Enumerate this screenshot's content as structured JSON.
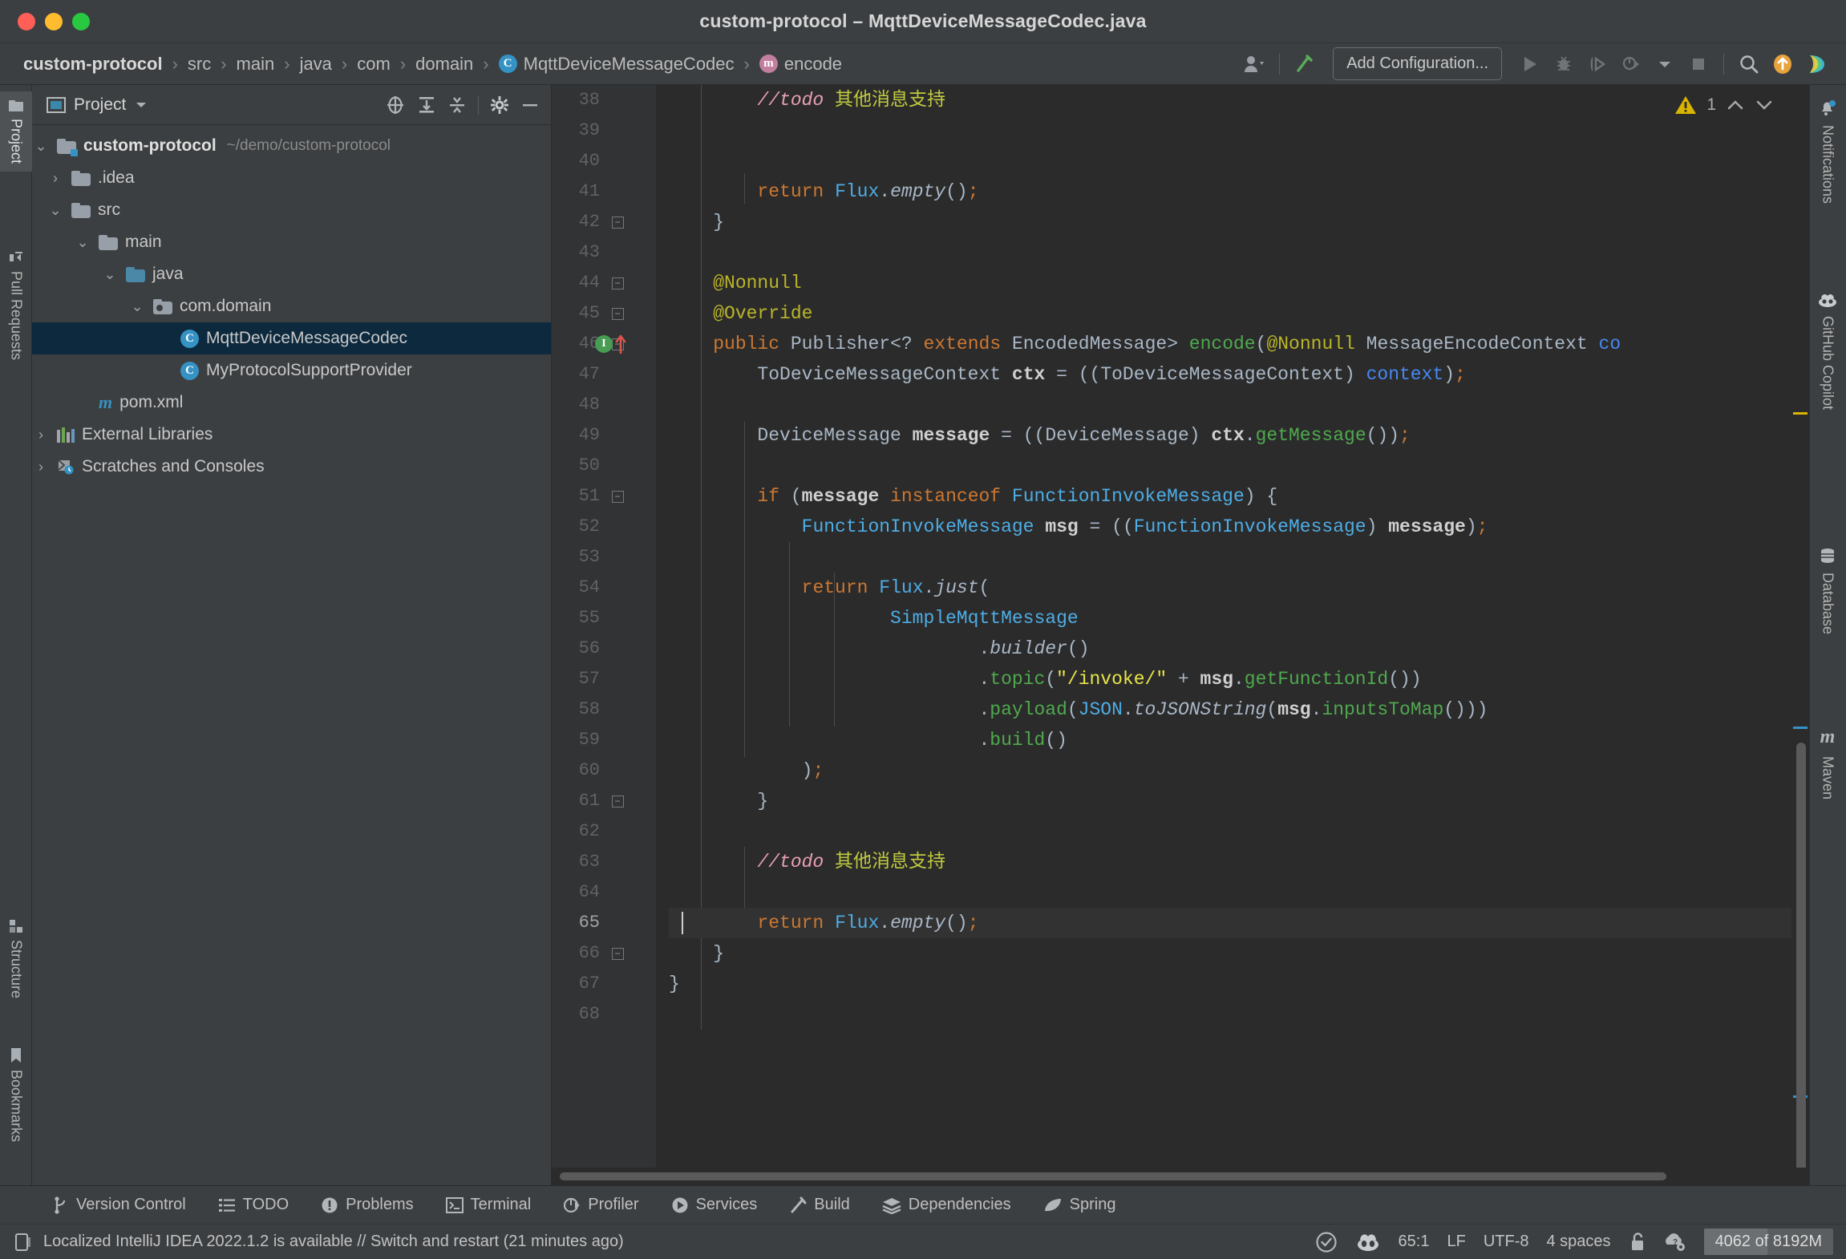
{
  "window": {
    "title": "custom-protocol – MqttDeviceMessageCodec.java"
  },
  "breadcrumb": {
    "items": [
      {
        "label": "custom-protocol",
        "icon": null
      },
      {
        "label": "src",
        "icon": null
      },
      {
        "label": "main",
        "icon": null
      },
      {
        "label": "java",
        "icon": null
      },
      {
        "label": "com",
        "icon": null
      },
      {
        "label": "domain",
        "icon": null
      },
      {
        "label": "MqttDeviceMessageCodec",
        "icon": "class-badge"
      },
      {
        "label": "encode",
        "icon": "method-badge"
      }
    ],
    "separator": "›"
  },
  "navbar_right": {
    "add_configuration_label": "Add Configuration...",
    "icons": [
      "user-icon",
      "build-hammer-icon",
      "run-icon",
      "debug-icon",
      "run-coverage-icon",
      "profile-icon",
      "dropdown-icon",
      "stop-icon",
      "search-icon",
      "update-icon",
      "copilot-icon"
    ]
  },
  "left_strip": {
    "tabs": [
      {
        "label": "Project",
        "icon": "project-folder-icon",
        "active": true
      },
      {
        "label": "Pull Requests",
        "icon": "pull-request-icon",
        "active": false
      },
      {
        "label": "Structure",
        "icon": "structure-icon",
        "active": false
      },
      {
        "label": "Bookmarks",
        "icon": "bookmark-icon",
        "active": false
      }
    ]
  },
  "right_strip": {
    "tabs": [
      {
        "label": "Notifications",
        "icon": "bell-icon"
      },
      {
        "label": "GitHub Copilot",
        "icon": "copilot-icon"
      },
      {
        "label": "Database",
        "icon": "database-icon"
      },
      {
        "label": "Maven",
        "icon": "maven-icon"
      }
    ]
  },
  "project_panel": {
    "title": "Project",
    "header_icons": [
      "locate-icon",
      "expand-all-icon",
      "collapse-all-icon",
      "settings-gear-icon",
      "hide-icon"
    ],
    "tree": [
      {
        "label": "custom-protocol",
        "path": "~/demo/custom-protocol",
        "indent": 0,
        "chevron": "down",
        "icon": "module-folder-icon",
        "bold": true,
        "selected": false
      },
      {
        "label": ".idea",
        "path": "",
        "indent": 1,
        "chevron": "right",
        "icon": "folder-icon",
        "bold": false,
        "selected": false
      },
      {
        "label": "src",
        "path": "",
        "indent": 1,
        "chevron": "down",
        "icon": "folder-icon",
        "bold": false,
        "selected": false
      },
      {
        "label": "main",
        "path": "",
        "indent": 2,
        "chevron": "down",
        "icon": "folder-icon",
        "bold": false,
        "selected": false
      },
      {
        "label": "java",
        "path": "",
        "indent": 3,
        "chevron": "down",
        "icon": "source-folder-icon",
        "bold": false,
        "selected": false
      },
      {
        "label": "com.domain",
        "path": "",
        "indent": 4,
        "chevron": "down",
        "icon": "package-icon",
        "bold": false,
        "selected": false
      },
      {
        "label": "MqttDeviceMessageCodec",
        "path": "",
        "indent": 5,
        "chevron": "none",
        "icon": "class-icon",
        "bold": false,
        "selected": true
      },
      {
        "label": "MyProtocolSupportProvider",
        "path": "",
        "indent": 5,
        "chevron": "none",
        "icon": "class-icon",
        "bold": false,
        "selected": false
      },
      {
        "label": "pom.xml",
        "path": "",
        "indent": 2,
        "chevron": "none",
        "icon": "maven-file-icon",
        "bold": false,
        "selected": false
      },
      {
        "label": "External Libraries",
        "path": "",
        "indent": 0,
        "chevron": "right",
        "icon": "libraries-icon",
        "bold": false,
        "selected": false
      },
      {
        "label": "Scratches and Consoles",
        "path": "",
        "indent": 0,
        "chevron": "right",
        "icon": "scratches-icon",
        "bold": false,
        "selected": false
      }
    ]
  },
  "editor": {
    "warning_count": "1",
    "first_line_number": 38,
    "current_line": 65,
    "lines": [
      {
        "n": 38,
        "fold": null,
        "gutter_icon": null
      },
      {
        "n": 39,
        "fold": null,
        "gutter_icon": null
      },
      {
        "n": 40,
        "fold": null,
        "gutter_icon": null
      },
      {
        "n": 41,
        "fold": null,
        "gutter_icon": null
      },
      {
        "n": 42,
        "fold": "end",
        "gutter_icon": null
      },
      {
        "n": 43,
        "fold": null,
        "gutter_icon": null
      },
      {
        "n": 44,
        "fold": "start",
        "gutter_icon": null
      },
      {
        "n": 45,
        "fold": "start",
        "gutter_icon": null
      },
      {
        "n": 46,
        "fold": "start",
        "gutter_icon": "implements-method-icon"
      },
      {
        "n": 47,
        "fold": null,
        "gutter_icon": null
      },
      {
        "n": 48,
        "fold": null,
        "gutter_icon": null
      },
      {
        "n": 49,
        "fold": null,
        "gutter_icon": null
      },
      {
        "n": 50,
        "fold": null,
        "gutter_icon": null
      },
      {
        "n": 51,
        "fold": "start",
        "gutter_icon": null
      },
      {
        "n": 52,
        "fold": null,
        "gutter_icon": null
      },
      {
        "n": 53,
        "fold": null,
        "gutter_icon": null
      },
      {
        "n": 54,
        "fold": null,
        "gutter_icon": null
      },
      {
        "n": 55,
        "fold": null,
        "gutter_icon": null
      },
      {
        "n": 56,
        "fold": null,
        "gutter_icon": null
      },
      {
        "n": 57,
        "fold": null,
        "gutter_icon": null
      },
      {
        "n": 58,
        "fold": null,
        "gutter_icon": null
      },
      {
        "n": 59,
        "fold": null,
        "gutter_icon": null
      },
      {
        "n": 60,
        "fold": null,
        "gutter_icon": null
      },
      {
        "n": 61,
        "fold": "end",
        "gutter_icon": null
      },
      {
        "n": 62,
        "fold": null,
        "gutter_icon": null
      },
      {
        "n": 63,
        "fold": null,
        "gutter_icon": null
      },
      {
        "n": 64,
        "fold": null,
        "gutter_icon": null
      },
      {
        "n": 65,
        "fold": null,
        "gutter_icon": null
      },
      {
        "n": 66,
        "fold": "end",
        "gutter_icon": null
      },
      {
        "n": 67,
        "fold": null,
        "gutter_icon": null
      },
      {
        "n": 68,
        "fold": null,
        "gutter_icon": null
      }
    ],
    "source_text": [
      "        //todo 其他消息支持",
      "",
      "",
      "        return Flux.empty();",
      "    }",
      "",
      "    @Nonnull",
      "    @Override",
      "    public Publisher<? extends EncodedMessage> encode(@Nonnull MessageEncodeContext co",
      "        ToDeviceMessageContext ctx = ((ToDeviceMessageContext) context);",
      "",
      "        DeviceMessage message = ((DeviceMessage) ctx.getMessage());",
      "",
      "        if (message instanceof FunctionInvokeMessage) {",
      "            FunctionInvokeMessage msg = ((FunctionInvokeMessage) message);",
      "",
      "            return Flux.just(",
      "                    SimpleMqttMessage",
      "                            .builder()",
      "                            .topic(\"/invoke/\" + msg.getFunctionId())",
      "                            .payload(JSON.toJSONString(msg.inputsToMap()))",
      "                            .build()",
      "            );",
      "        }",
      "",
      "        //todo 其他消息支持",
      "",
      "        return Flux.empty();",
      "    }",
      "}",
      ""
    ]
  },
  "bottom_toolbar": {
    "items": [
      {
        "label": "Version Control",
        "icon": "branch-icon"
      },
      {
        "label": "TODO",
        "icon": "todo-list-icon"
      },
      {
        "label": "Problems",
        "icon": "problems-icon"
      },
      {
        "label": "Terminal",
        "icon": "terminal-icon"
      },
      {
        "label": "Profiler",
        "icon": "profiler-icon"
      },
      {
        "label": "Services",
        "icon": "services-icon"
      },
      {
        "label": "Build",
        "icon": "build-hammer-icon"
      },
      {
        "label": "Dependencies",
        "icon": "dependencies-icon"
      },
      {
        "label": "Spring",
        "icon": "spring-leaf-icon"
      }
    ]
  },
  "statusbar": {
    "message": "Localized IntelliJ IDEA 2022.1.2 is available // Switch and restart (21 minutes ago)",
    "message_icon": "popup-icon",
    "caret_position": "65:1",
    "line_separator": "LF",
    "encoding": "UTF-8",
    "indent": "4 spaces",
    "lock_icon": "unlocked-icon",
    "inspection_icon": "inspection-widget-icon",
    "checkmark_icon": "checkmark-circle-icon",
    "copilot_icon": "copilot-status-icon",
    "memory": "4062 of 8192M"
  },
  "colors": {
    "background": "#3c3f41",
    "editor_bg": "#2b2b2b",
    "gutter_bg": "#313335",
    "selection": "#0d293e",
    "accent_blue": "#3592c4",
    "warning_yellow": "#d9b400",
    "keyword_orange": "#cc7832",
    "string_yellow": "#e8e54a",
    "method_green": "#4fa94f",
    "type_cyan": "#4eade5"
  }
}
